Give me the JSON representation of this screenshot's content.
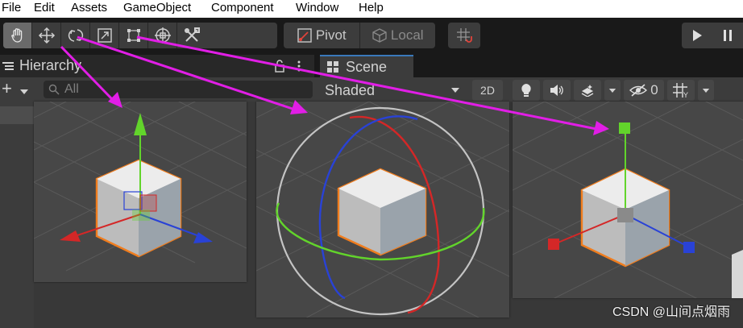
{
  "menu": [
    "File",
    "Edit",
    "Assets",
    "GameObject",
    "Component",
    "Window",
    "Help"
  ],
  "toolbar": {
    "tools": [
      "hand-tool",
      "move-tool",
      "rotate-tool",
      "scale-tool",
      "rect-tool",
      "transform-tool",
      "custom-tool"
    ],
    "pivot_label": "Pivot",
    "local_label": "Local"
  },
  "hierarchy": {
    "tab_label": "Hierarchy",
    "search_placeholder": "All"
  },
  "scene": {
    "tab_label": "Scene",
    "shading_mode": "Shaded",
    "mode_2d": "2D",
    "hidden_count": "0"
  },
  "gizmos": [
    "move",
    "rotate",
    "scale"
  ],
  "watermark": "CSDN @山间点烟雨",
  "colors": {
    "arrow": "#e11ee6",
    "x_axis": "#d42727",
    "y_axis": "#62d42b",
    "z_axis": "#2942d6",
    "outline": "#f07d1e",
    "tab_accent": "#3a79bb"
  }
}
